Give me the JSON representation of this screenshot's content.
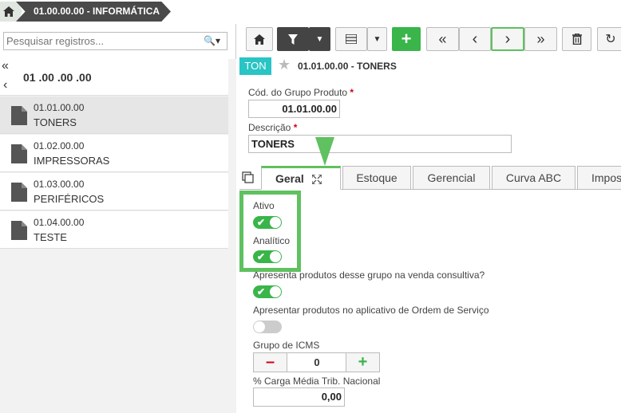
{
  "breadcrumb": {
    "home_icon": "home-icon",
    "current": "01.00.00.00 - INFORMÁTICA"
  },
  "search": {
    "placeholder": "Pesquisar registros..."
  },
  "tree": {
    "current_code": "01 .00 .00 .00",
    "items": [
      {
        "code": "01.01.00.00",
        "name": "TONERS",
        "selected": true
      },
      {
        "code": "01.02.00.00",
        "name": "IMPRESSORAS"
      },
      {
        "code": "01.03.00.00",
        "name": "PERIFÉRICOS"
      },
      {
        "code": "01.04.00.00",
        "name": "TESTE"
      }
    ]
  },
  "toolbar": {
    "new_label": "+"
  },
  "record": {
    "badge": "TON",
    "title": "01.01.00.00 - TONERS"
  },
  "form": {
    "code_label": "Cód. do Grupo Produto",
    "code_value": "01.01.00.00",
    "desc_label": "Descrição",
    "desc_value": "TONERS",
    "required_mark": "*"
  },
  "tabs": [
    "Geral",
    "Estoque",
    "Gerencial",
    "Curva ABC",
    "Impos"
  ],
  "geral": {
    "ativo_label": "Ativo",
    "ativo_on": true,
    "analitico_label": "Analítico",
    "analitico_on": true,
    "venda_label": "Apresenta produtos desse grupo na venda consultiva?",
    "venda_on": true,
    "os_label": "Apresentar produtos no aplicativo de Ordem de Serviço",
    "os_on": false,
    "icms_label": "Grupo de ICMS",
    "icms_value": "0",
    "carga_label": "% Carga Média Trib. Nacional",
    "carga_value": "0,00"
  },
  "colors": {
    "accent_green": "#39b54a",
    "badge": "#29c4c4",
    "highlight": "#5fc15f"
  }
}
